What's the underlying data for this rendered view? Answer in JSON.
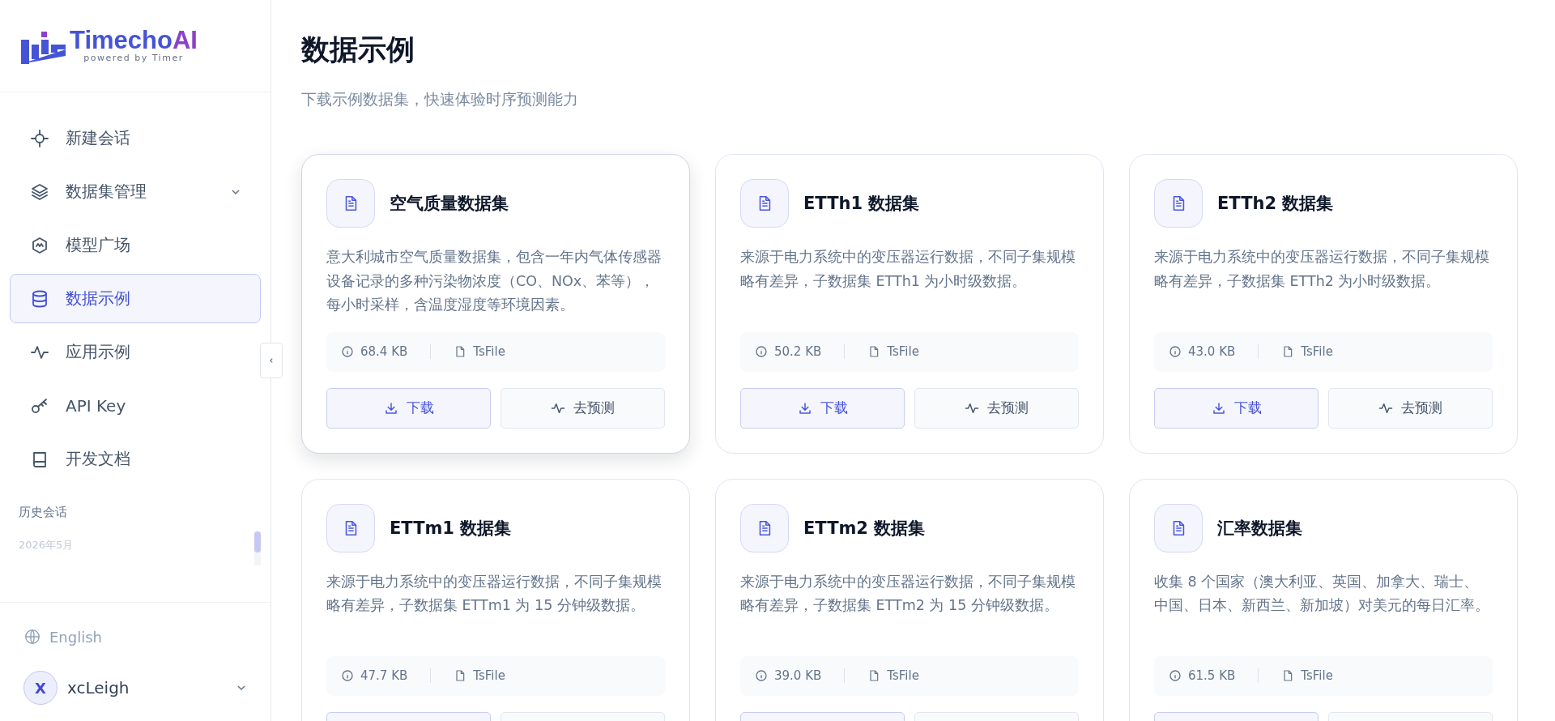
{
  "sidebar": {
    "logo": {
      "name": "Timecho",
      "suffix": "AI",
      "tagline": "powered by Timer"
    },
    "nav": [
      {
        "label": "新建会话",
        "selected": false
      },
      {
        "label": "数据集管理",
        "selected": false,
        "expanded": false
      },
      {
        "label": "模型广场",
        "selected": false
      },
      {
        "label": "数据示例",
        "selected": true
      },
      {
        "label": "应用示例",
        "selected": false
      },
      {
        "label": "API Key",
        "selected": false
      },
      {
        "label": "开发文档",
        "selected": false
      }
    ],
    "history": {
      "title": "历史会话",
      "groups": [
        "2026年5月"
      ]
    },
    "language": "English",
    "user": {
      "initial": "X",
      "name": "xcLeigh"
    }
  },
  "page": {
    "title": "数据示例",
    "subtitle": "下载示例数据集，快速体验时序预测能力"
  },
  "cards": [
    {
      "title": "空气质量数据集",
      "hovered": true,
      "description": "意大利城市空气质量数据集，包含一年内气体传感器设备记录的多种污染物浓度（CO、NOx、苯等），每小时采样，含温度湿度等环境因素。",
      "size": "68.4 KB",
      "format": "TsFile",
      "buttons": [
        {
          "kind": "download",
          "label": "下载"
        },
        {
          "kind": "predict",
          "label": "去预测"
        }
      ]
    },
    {
      "title": "ETTh1 数据集",
      "hovered": false,
      "description": "来源于电力系统中的变压器运行数据，不同子集规模略有差异，子数据集 ETTh1 为小时级数据。",
      "size": "50.2 KB",
      "format": "TsFile",
      "buttons": [
        {
          "kind": "download",
          "label": "下载"
        },
        {
          "kind": "predict",
          "label": "去预测"
        }
      ]
    },
    {
      "title": "ETTh2 数据集",
      "hovered": false,
      "description": "来源于电力系统中的变压器运行数据，不同子集规模略有差异，子数据集 ETTh2 为小时级数据。",
      "size": "43.0 KB",
      "format": "TsFile",
      "buttons": [
        {
          "kind": "download",
          "label": "下载"
        },
        {
          "kind": "predict",
          "label": "去预测"
        }
      ]
    },
    {
      "title": "ETTm1 数据集",
      "hovered": false,
      "description": "来源于电力系统中的变压器运行数据，不同子集规模略有差异，子数据集 ETTm1 为 15 分钟级数据。",
      "size": "47.7 KB",
      "format": "TsFile",
      "buttons": [
        {
          "kind": "download"
        },
        {
          "kind": "predict"
        }
      ]
    },
    {
      "title": "ETTm2 数据集",
      "hovered": false,
      "description": "来源于电力系统中的变压器运行数据，不同子集规模略有差异，子数据集 ETTm2 为 15 分钟级数据。",
      "size": "39.0 KB",
      "format": "TsFile",
      "buttons": [
        {
          "kind": "download"
        },
        {
          "kind": "predict"
        }
      ]
    },
    {
      "title": "汇率数据集",
      "hovered": false,
      "description": "收集 8 个国家（澳大利亚、英国、加拿大、瑞士、中国、日本、新西兰、新加坡）对美元的每日汇率。",
      "size": "61.5 KB",
      "format": "TsFile",
      "buttons": [
        {
          "kind": "download"
        },
        {
          "kind": "predict"
        }
      ]
    }
  ]
}
